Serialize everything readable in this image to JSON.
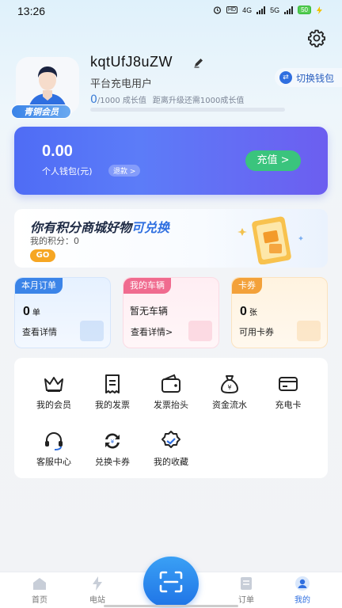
{
  "status_bar": {
    "time": "13:26",
    "icons": [
      "alarm-icon",
      "hd-icon",
      "signal-4g",
      "signal-5g",
      "battery"
    ],
    "network_a": "4G",
    "network_b": "5G",
    "hd_label": "HD",
    "battery_level": "50"
  },
  "header": {
    "settings_icon": "gear-icon"
  },
  "profile": {
    "username": "kqtUfJ8uZW",
    "user_type": "平台充电用户",
    "member_badge": "青铜会员",
    "switch_wallet_label": "切换钱包",
    "growth_current": "0",
    "growth_total_text": "/1000 成长值",
    "growth_hint": "距离升级还需1000成长值",
    "growth_progress": 0.0
  },
  "wallet": {
    "amount": "0.00",
    "label": "个人钱包(元)",
    "refund_label": "退款 >",
    "recharge_label": "充值 >"
  },
  "points_banner": {
    "title_main": "你有积分商城好物",
    "title_highlight": "可兑换",
    "points_text": "我的积分：0",
    "go_label": "GO"
  },
  "mini_cards": {
    "orders": {
      "tag": "本月订单",
      "value": "0",
      "unit": "单",
      "link": "查看详情"
    },
    "vehicle": {
      "tag": "我的车辆",
      "text": "暂无车辆",
      "link": "查看详情>"
    },
    "coupons": {
      "tag": "卡券",
      "value": "0",
      "unit": "张",
      "link": "可用卡券"
    }
  },
  "menu": {
    "items": [
      {
        "label": "我的会员",
        "icon": "crown-icon"
      },
      {
        "label": "我的发票",
        "icon": "invoice-icon"
      },
      {
        "label": "发票抬头",
        "icon": "wallet-icon"
      },
      {
        "label": "资金流水",
        "icon": "money-bag-icon"
      },
      {
        "label": "充电卡",
        "icon": "card-icon"
      },
      {
        "label": "客服中心",
        "icon": "headset-icon"
      },
      {
        "label": "兑换卡券",
        "icon": "exchange-icon"
      },
      {
        "label": "我的收藏",
        "icon": "favorite-icon"
      }
    ]
  },
  "tabbar": {
    "tabs": [
      {
        "label": "首页",
        "icon": "home-icon"
      },
      {
        "label": "电站",
        "icon": "station-icon"
      },
      {
        "label": "订单",
        "icon": "order-icon"
      },
      {
        "label": "我的",
        "icon": "profile-icon"
      }
    ],
    "active_index": 3,
    "center_icon": "scan-icon"
  },
  "colors": {
    "accent": "#2f6fe0",
    "recharge": "#3ac47d",
    "go": "#f6a623"
  }
}
